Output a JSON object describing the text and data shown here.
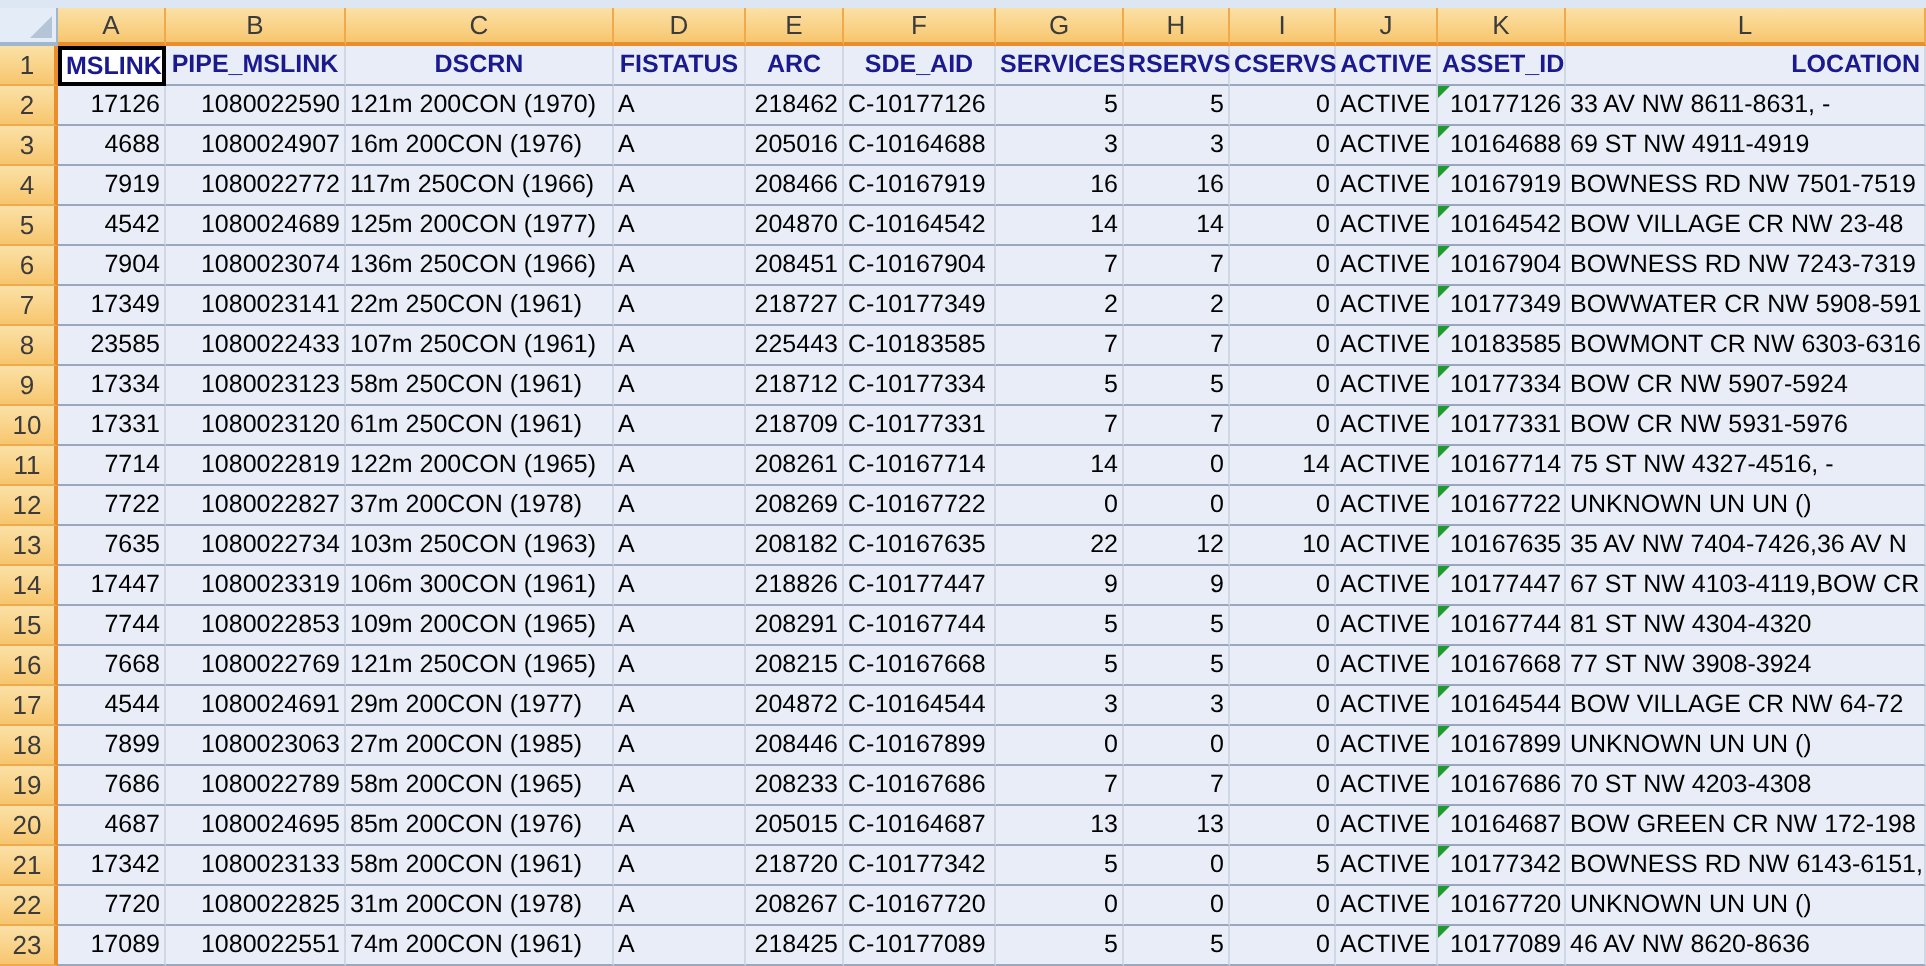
{
  "columns": [
    "A",
    "B",
    "C",
    "D",
    "E",
    "F",
    "G",
    "H",
    "I",
    "J",
    "K",
    "L"
  ],
  "header_row": {
    "number": "1",
    "cells": [
      {
        "text": "MSLINK",
        "selected": true
      },
      {
        "text": "PIPE_MSLINK",
        "selected": false
      },
      {
        "text": "DSCRN",
        "selected": false
      },
      {
        "text": "FISTATUS",
        "selected": false
      },
      {
        "text": "ARC",
        "selected": false
      },
      {
        "text": "SDE_AID",
        "selected": false
      },
      {
        "text": "SERVICES",
        "selected": false
      },
      {
        "text": "RSERVS",
        "selected": false
      },
      {
        "text": "CSERVS",
        "selected": false
      },
      {
        "text": "ACTIVE",
        "selected": false
      },
      {
        "text": "ASSET_ID",
        "selected": false
      },
      {
        "text": "LOCATION",
        "selected": false
      }
    ]
  },
  "rows": [
    {
      "number": "2",
      "warning": true,
      "cells": [
        "17126",
        "1080022590",
        "121m 200CON (1970)",
        "A",
        "218462",
        "C-10177126",
        "5",
        "5",
        "0",
        "ACTIVE",
        "10177126",
        "33 AV NW 8611-8631, -"
      ]
    },
    {
      "number": "3",
      "warning": true,
      "cells": [
        "4688",
        "1080024907",
        "16m 200CON (1976)",
        "A",
        "205016",
        "C-10164688",
        "3",
        "3",
        "0",
        "ACTIVE",
        "10164688",
        "69 ST NW 4911-4919"
      ]
    },
    {
      "number": "4",
      "warning": true,
      "cells": [
        "7919",
        "1080022772",
        "117m 250CON (1966)",
        "A",
        "208466",
        "C-10167919",
        "16",
        "16",
        "0",
        "ACTIVE",
        "10167919",
        "BOWNESS RD NW 7501-7519"
      ]
    },
    {
      "number": "5",
      "warning": true,
      "cells": [
        "4542",
        "1080024689",
        "125m 200CON (1977)",
        "A",
        "204870",
        "C-10164542",
        "14",
        "14",
        "0",
        "ACTIVE",
        "10164542",
        "BOW VILLAGE CR NW 23-48"
      ]
    },
    {
      "number": "6",
      "warning": true,
      "cells": [
        "7904",
        "1080023074",
        "136m 250CON (1966)",
        "A",
        "208451",
        "C-10167904",
        "7",
        "7",
        "0",
        "ACTIVE",
        "10167904",
        "BOWNESS RD NW 7243-7319"
      ]
    },
    {
      "number": "7",
      "warning": true,
      "cells": [
        "17349",
        "1080023141",
        "22m 250CON (1961)",
        "A",
        "218727",
        "C-10177349",
        "2",
        "2",
        "0",
        "ACTIVE",
        "10177349",
        "BOWWATER CR NW 5908-591"
      ]
    },
    {
      "number": "8",
      "warning": true,
      "cells": [
        "23585",
        "1080022433",
        "107m 250CON (1961)",
        "A",
        "225443",
        "C-10183585",
        "7",
        "7",
        "0",
        "ACTIVE",
        "10183585",
        "BOWMONT CR NW 6303-6316"
      ]
    },
    {
      "number": "9",
      "warning": true,
      "cells": [
        "17334",
        "1080023123",
        "58m 250CON (1961)",
        "A",
        "218712",
        "C-10177334",
        "5",
        "5",
        "0",
        "ACTIVE",
        "10177334",
        "BOW CR NW 5907-5924"
      ]
    },
    {
      "number": "10",
      "warning": true,
      "cells": [
        "17331",
        "1080023120",
        "61m 250CON (1961)",
        "A",
        "218709",
        "C-10177331",
        "7",
        "7",
        "0",
        "ACTIVE",
        "10177331",
        "BOW CR NW 5931-5976"
      ]
    },
    {
      "number": "11",
      "warning": true,
      "cells": [
        "7714",
        "1080022819",
        "122m 200CON (1965)",
        "A",
        "208261",
        "C-10167714",
        "14",
        "0",
        "14",
        "ACTIVE",
        "10167714",
        "75 ST NW 4327-4516, -"
      ]
    },
    {
      "number": "12",
      "warning": true,
      "cells": [
        "7722",
        "1080022827",
        "37m 200CON (1978)",
        "A",
        "208269",
        "C-10167722",
        "0",
        "0",
        "0",
        "ACTIVE",
        "10167722",
        "UNKNOWN UN UN ()"
      ]
    },
    {
      "number": "13",
      "warning": true,
      "cells": [
        "7635",
        "1080022734",
        "103m 250CON (1963)",
        "A",
        "208182",
        "C-10167635",
        "22",
        "12",
        "10",
        "ACTIVE",
        "10167635",
        "35 AV NW 7404-7426,36 AV N"
      ]
    },
    {
      "number": "14",
      "warning": true,
      "cells": [
        "17447",
        "1080023319",
        "106m 300CON (1961)",
        "A",
        "218826",
        "C-10177447",
        "9",
        "9",
        "0",
        "ACTIVE",
        "10177447",
        "67 ST NW 4103-4119,BOW CR"
      ]
    },
    {
      "number": "15",
      "warning": true,
      "cells": [
        "7744",
        "1080022853",
        "109m 200CON (1965)",
        "A",
        "208291",
        "C-10167744",
        "5",
        "5",
        "0",
        "ACTIVE",
        "10167744",
        "81 ST NW 4304-4320"
      ]
    },
    {
      "number": "16",
      "warning": true,
      "cells": [
        "7668",
        "1080022769",
        "121m 250CON (1965)",
        "A",
        "208215",
        "C-10167668",
        "5",
        "5",
        "0",
        "ACTIVE",
        "10167668",
        "77 ST NW 3908-3924"
      ]
    },
    {
      "number": "17",
      "warning": true,
      "cells": [
        "4544",
        "1080024691",
        "29m 200CON (1977)",
        "A",
        "204872",
        "C-10164544",
        "3",
        "3",
        "0",
        "ACTIVE",
        "10164544",
        "BOW VILLAGE CR NW 64-72"
      ]
    },
    {
      "number": "18",
      "warning": true,
      "cells": [
        "7899",
        "1080023063",
        "27m 200CON (1985)",
        "A",
        "208446",
        "C-10167899",
        "0",
        "0",
        "0",
        "ACTIVE",
        "10167899",
        "UNKNOWN UN UN ()"
      ]
    },
    {
      "number": "19",
      "warning": true,
      "cells": [
        "7686",
        "1080022789",
        "58m 200CON (1965)",
        "A",
        "208233",
        "C-10167686",
        "7",
        "7",
        "0",
        "ACTIVE",
        "10167686",
        "70 ST NW 4203-4308"
      ]
    },
    {
      "number": "20",
      "warning": true,
      "cells": [
        "4687",
        "1080024695",
        "85m 200CON (1976)",
        "A",
        "205015",
        "C-10164687",
        "13",
        "13",
        "0",
        "ACTIVE",
        "10164687",
        "BOW GREEN CR NW 172-198"
      ]
    },
    {
      "number": "21",
      "warning": true,
      "cells": [
        "17342",
        "1080023133",
        "58m 200CON (1961)",
        "A",
        "218720",
        "C-10177342",
        "5",
        "0",
        "5",
        "ACTIVE",
        "10177342",
        "BOWNESS RD NW 6143-6151,"
      ]
    },
    {
      "number": "22",
      "warning": true,
      "cells": [
        "7720",
        "1080022825",
        "31m 200CON (1978)",
        "A",
        "208267",
        "C-10167720",
        "0",
        "0",
        "0",
        "ACTIVE",
        "10167720",
        "UNKNOWN UN UN ()"
      ]
    },
    {
      "number": "23",
      "warning": true,
      "cells": [
        "17089",
        "1080022551",
        "74m 200CON (1961)",
        "A",
        "218425",
        "C-10177089",
        "5",
        "5",
        "0",
        "ACTIVE",
        "10177089",
        "46 AV NW 8620-8636"
      ]
    }
  ]
}
